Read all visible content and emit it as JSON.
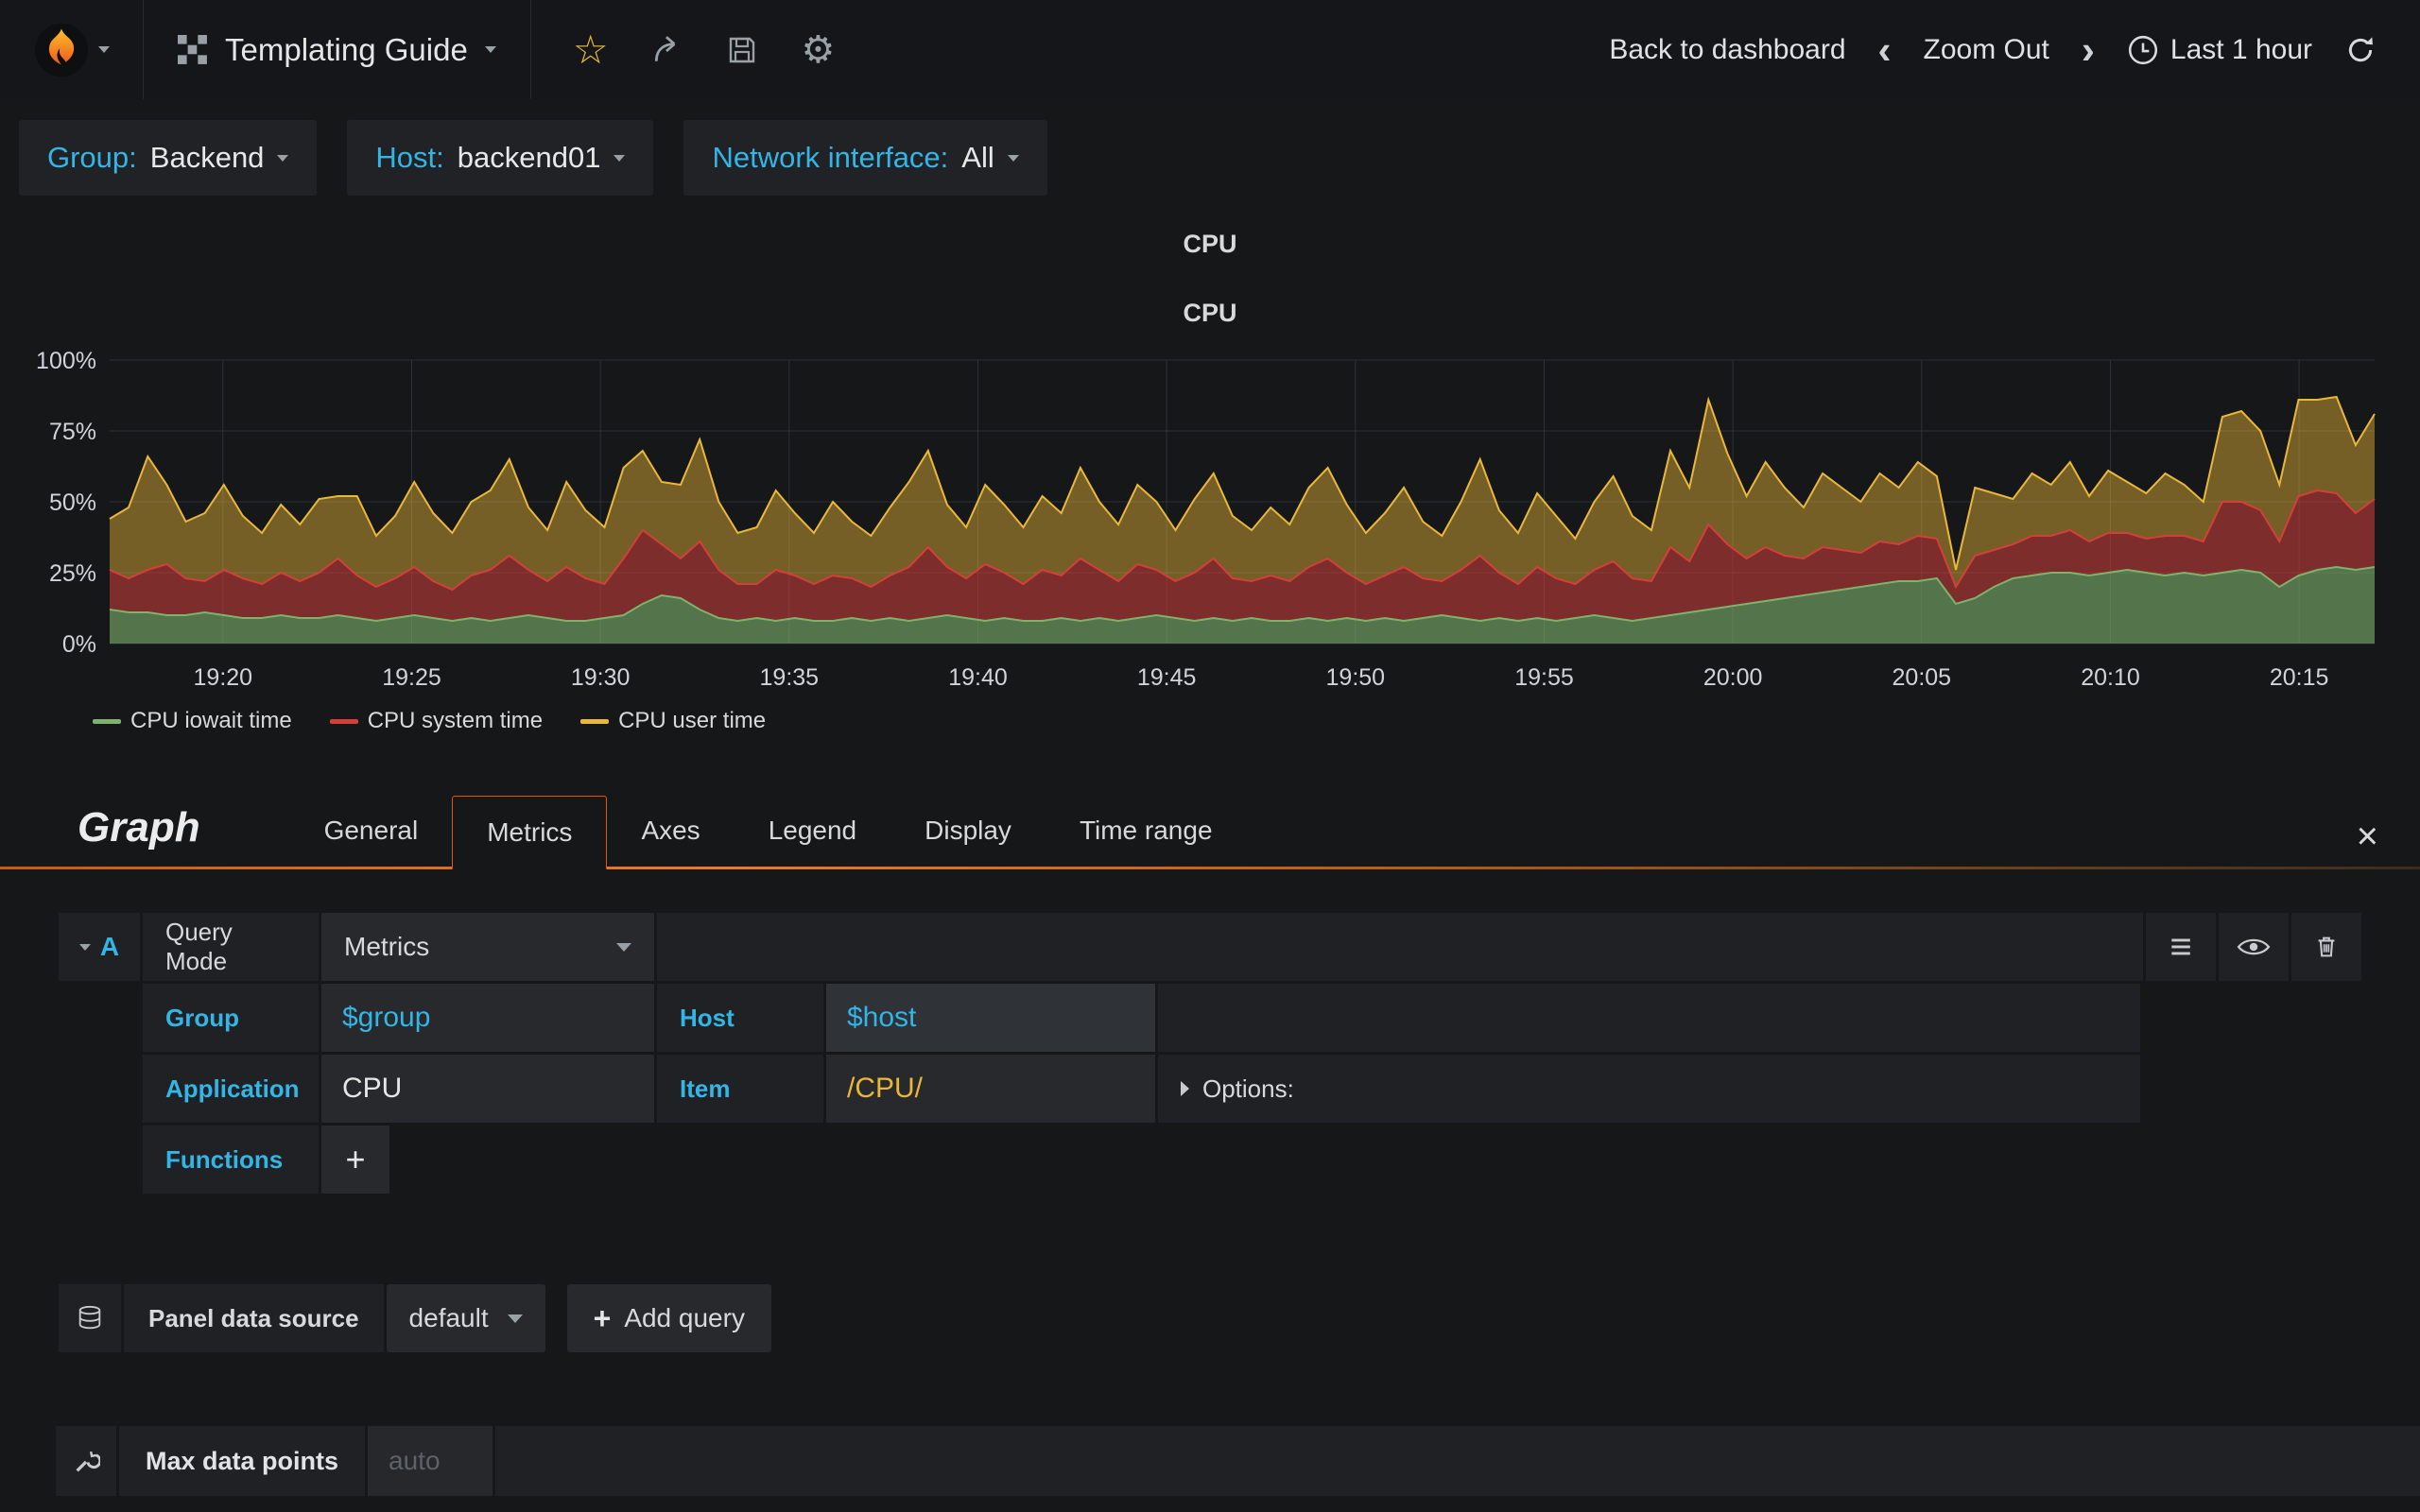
{
  "navbar": {
    "dashboard_title": "Templating Guide",
    "back_label": "Back to dashboard",
    "zoom_out_label": "Zoom Out",
    "time_label": "Last 1 hour"
  },
  "icons": {
    "star": "☆",
    "gear": "⚙",
    "hamburger": "≡",
    "close": "×",
    "chev_left": "‹",
    "chev_right": "›",
    "plus": "+"
  },
  "template_vars": [
    {
      "label": "Group:",
      "value": "Backend"
    },
    {
      "label": "Host:",
      "value": "backend01"
    },
    {
      "label": "Network interface:",
      "value": "All"
    }
  ],
  "panel": {
    "title": "CPU",
    "chart_title": "CPU"
  },
  "chart_data": {
    "type": "area",
    "stacked": true,
    "title": "CPU",
    "grid": true,
    "legend_position": "bottom-left",
    "ylim": [
      0,
      100
    ],
    "y_ticks": [
      "0%",
      "25%",
      "50%",
      "75%",
      "100%"
    ],
    "x_ticks": [
      "19:20",
      "19:25",
      "19:30",
      "19:35",
      "19:40",
      "19:45",
      "19:50",
      "19:55",
      "20:00",
      "20:05",
      "20:10",
      "20:15"
    ],
    "x_tick_minutes": [
      3,
      8,
      13,
      18,
      23,
      28,
      33,
      38,
      43,
      48,
      53,
      58
    ],
    "x_range_minutes": 60,
    "series": [
      {
        "name": "CPU iowait time",
        "color": "#7eb26d",
        "fill_opacity": 0.6,
        "values": [
          12,
          11,
          11,
          10,
          10,
          11,
          10,
          9,
          9,
          10,
          9,
          9,
          10,
          9,
          8,
          9,
          10,
          9,
          8,
          9,
          8,
          9,
          10,
          9,
          8,
          8,
          9,
          10,
          14,
          17,
          16,
          12,
          9,
          8,
          9,
          8,
          9,
          8,
          8,
          9,
          8,
          9,
          8,
          9,
          10,
          9,
          8,
          9,
          8,
          8,
          9,
          8,
          9,
          8,
          9,
          10,
          9,
          8,
          9,
          8,
          9,
          8,
          8,
          9,
          8,
          9,
          8,
          9,
          8,
          9,
          10,
          9,
          8,
          9,
          8,
          9,
          8,
          9,
          10,
          9,
          8,
          9,
          10,
          11,
          12,
          13,
          14,
          15,
          16,
          17,
          18,
          19,
          20,
          21,
          22,
          22,
          23,
          14,
          16,
          20,
          23,
          24,
          25,
          25,
          24,
          25,
          26,
          25,
          24,
          25,
          24,
          25,
          26,
          25,
          20,
          24,
          26,
          27,
          26,
          27
        ]
      },
      {
        "name": "CPU system time",
        "color": "#d43f3a",
        "fill_opacity": 0.55,
        "values": [
          14,
          12,
          15,
          18,
          13,
          11,
          16,
          14,
          12,
          15,
          13,
          16,
          20,
          15,
          12,
          14,
          17,
          13,
          11,
          15,
          18,
          22,
          16,
          13,
          19,
          15,
          12,
          20,
          26,
          18,
          14,
          24,
          17,
          13,
          12,
          18,
          15,
          13,
          16,
          14,
          12,
          15,
          19,
          25,
          17,
          14,
          20,
          16,
          13,
          18,
          15,
          22,
          17,
          14,
          19,
          16,
          13,
          17,
          21,
          15,
          13,
          16,
          14,
          18,
          22,
          16,
          13,
          15,
          19,
          14,
          12,
          17,
          23,
          16,
          13,
          18,
          15,
          12,
          16,
          20,
          15,
          13,
          24,
          18,
          30,
          22,
          16,
          19,
          15,
          13,
          16,
          14,
          12,
          15,
          13,
          16,
          14,
          6,
          15,
          13,
          12,
          14,
          13,
          15,
          12,
          14,
          13,
          12,
          14,
          13,
          12,
          25,
          24,
          22,
          16,
          28,
          28,
          26,
          20,
          24
        ]
      },
      {
        "name": "CPU user time",
        "color": "#eab839",
        "fill_opacity": 0.45,
        "values": [
          18,
          25,
          40,
          28,
          20,
          24,
          30,
          22,
          18,
          24,
          20,
          26,
          22,
          28,
          18,
          22,
          30,
          24,
          20,
          26,
          28,
          34,
          22,
          18,
          30,
          24,
          20,
          32,
          28,
          22,
          26,
          36,
          24,
          18,
          20,
          28,
          22,
          18,
          26,
          20,
          18,
          24,
          30,
          34,
          22,
          18,
          28,
          24,
          20,
          26,
          22,
          32,
          24,
          20,
          28,
          24,
          18,
          26,
          30,
          22,
          18,
          24,
          20,
          28,
          32,
          24,
          18,
          22,
          28,
          20,
          16,
          24,
          34,
          22,
          18,
          26,
          22,
          16,
          24,
          30,
          22,
          18,
          34,
          26,
          44,
          32,
          22,
          30,
          24,
          18,
          26,
          22,
          18,
          24,
          20,
          26,
          22,
          6,
          24,
          20,
          16,
          22,
          18,
          24,
          16,
          22,
          18,
          16,
          22,
          18,
          14,
          30,
          32,
          28,
          20,
          34,
          32,
          34,
          24,
          30
        ]
      }
    ]
  },
  "editor": {
    "panel_type": "Graph",
    "tabs": [
      "General",
      "Metrics",
      "Axes",
      "Legend",
      "Display",
      "Time range"
    ],
    "active_tab": "Metrics",
    "query": {
      "letter": "A",
      "mode_label": "Query Mode",
      "mode_value": "Metrics",
      "fields": {
        "group_label": "Group",
        "group_value": "$group",
        "host_label": "Host",
        "host_value": "$host",
        "app_label": "Application",
        "app_value": "CPU",
        "item_label": "Item",
        "item_value": "/CPU/"
      },
      "options_label": "Options:",
      "functions_label": "Functions"
    },
    "datasource": {
      "label": "Panel data source",
      "value": "default",
      "add_query_label": "Add query"
    },
    "max_data_points": {
      "label": "Max data points",
      "placeholder": "auto"
    }
  }
}
